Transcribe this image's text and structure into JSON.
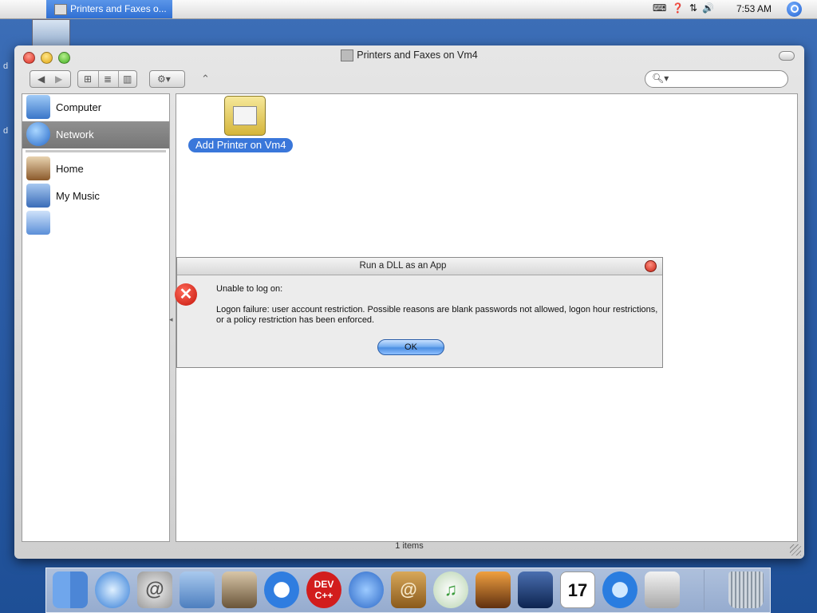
{
  "menubar": {
    "task_title": "Printers and Faxes o...",
    "clock": "7:53 AM"
  },
  "window": {
    "title": "Printers and Faxes on Vm4",
    "status": "1 items"
  },
  "sidebar": {
    "items": [
      {
        "label": "Computer"
      },
      {
        "label": "Network"
      },
      {
        "label": "Home"
      },
      {
        "label": "My Music"
      },
      {
        "label": ""
      }
    ]
  },
  "content": {
    "icon_label": "Add Printer on Vm4"
  },
  "dialog": {
    "title": "Run a DLL as an App",
    "message1": "Unable to log on:",
    "message2": "Logon failure: user account restriction.  Possible reasons are blank passwords not allowed, logon hour restrictions, or a policy restriction has been enforced.",
    "ok_label": "OK"
  },
  "dock": {
    "dev_label": "DEV C++",
    "calendar_day": "17"
  }
}
